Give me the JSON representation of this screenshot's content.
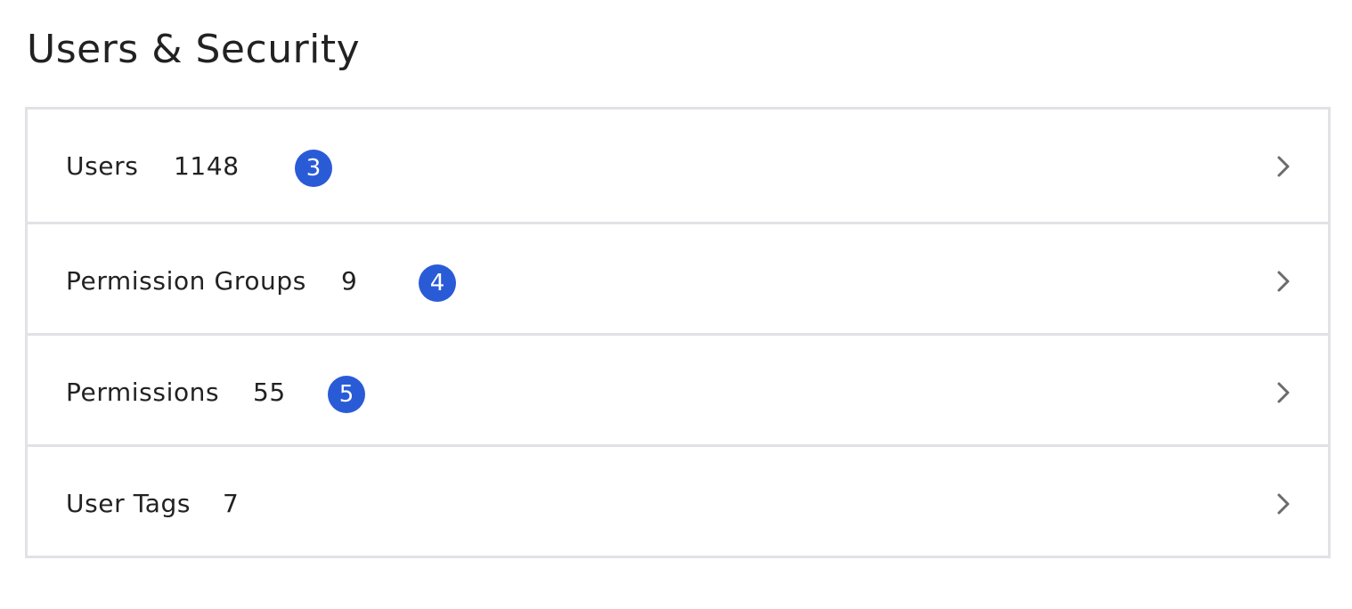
{
  "header": {
    "title": "Users & Security"
  },
  "rows": [
    {
      "label": "Users",
      "count": "1148",
      "badge": "3"
    },
    {
      "label": "Permission Groups",
      "count": "9",
      "badge": "4"
    },
    {
      "label": "Permissions",
      "count": "55",
      "badge": "5"
    },
    {
      "label": "User Tags",
      "count": "7",
      "badge": ""
    }
  ],
  "icons": {
    "row_arrow": "chevron-right-icon"
  },
  "colors": {
    "badge_bg": "#2a5bd7",
    "border": "#e1e1e6",
    "chevron": "#6b6b6b"
  }
}
